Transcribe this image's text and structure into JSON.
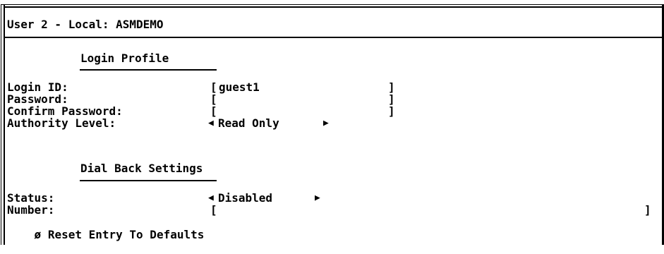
{
  "window": {
    "title": "User 2 - Local: ASMDEMO"
  },
  "login_profile": {
    "heading": "Login Profile",
    "fields": {
      "login_id": {
        "label": "Login ID:",
        "value": "guest1",
        "open_bracket": "[",
        "close_bracket": "]"
      },
      "password": {
        "label": "Password:",
        "value": "",
        "open_bracket": "[",
        "close_bracket": "]"
      },
      "confirm_password": {
        "label": "Confirm Password:",
        "value": "",
        "open_bracket": "[",
        "close_bracket": "]"
      },
      "authority_level": {
        "label": "Authority Level:",
        "value": "Read Only",
        "left_arrow": "◀",
        "right_arrow": "▶"
      }
    }
  },
  "dial_back": {
    "heading": "Dial Back Settings",
    "fields": {
      "status": {
        "label": "Status:",
        "value": "Disabled",
        "left_arrow": "◀",
        "right_arrow": "▶"
      },
      "number": {
        "label": "Number:",
        "value": "",
        "open_bracket": "[",
        "close_bracket": "]"
      }
    }
  },
  "reset": {
    "glyph": "ø",
    "label": "Reset Entry To Defaults"
  }
}
